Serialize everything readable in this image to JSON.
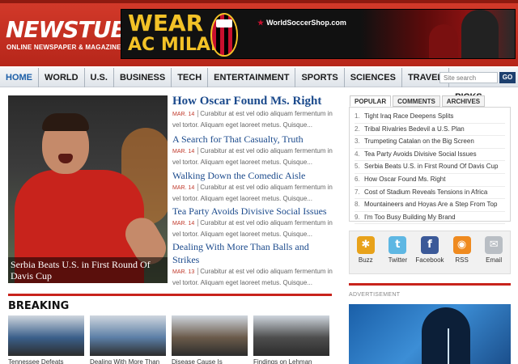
{
  "site": {
    "logo": "NEWSTUBE",
    "tagline": "ONLINE NEWSPAPER & MAGAZINE"
  },
  "banner": {
    "line1": "WEAR",
    "line2": "AC MILAN",
    "shop": "WorldSoccerShop.com"
  },
  "nav": {
    "items": [
      "HOME",
      "WORLD",
      "U.S.",
      "BUSINESS",
      "TECH",
      "ENTERTAINMENT",
      "SPORTS",
      "SCIENCES",
      "TRAVEL",
      "EDITOR'S PICKS"
    ],
    "search_placeholder": "Site search",
    "go_label": "GO"
  },
  "feature": {
    "caption": "Serbia Beats U.S. in First Round Of Davis Cup"
  },
  "articles": [
    {
      "title": "How Oscar Found Ms. Right",
      "date": "MAR. 14",
      "excerpt": "Curabitur at est vel odio aliquam fermentum in vel tortor. Aliquam eget laoreet metus. Quisque..."
    },
    {
      "title": "A Search for That Casualty, Truth",
      "date": "MAR. 14",
      "excerpt": "Curabitur at est vel odio aliquam fermentum in vel tortor. Aliquam eget laoreet metus. Quisque..."
    },
    {
      "title": "Walking Down the Comedic Aisle",
      "date": "MAR. 14",
      "excerpt": "Curabitur at est vel odio aliquam fermentum in vel tortor. Aliquam eget laoreet metus. Quisque..."
    },
    {
      "title": "Tea Party Avoids Divisive Social Issues",
      "date": "MAR. 14",
      "excerpt": "Curabitur at est vel odio aliquam fermentum in vel tortor. Aliquam eget laoreet metus. Quisque..."
    },
    {
      "title": "Dealing With More Than Balls and Strikes",
      "date": "MAR. 13",
      "excerpt": "Curabitur at est vel odio aliquam fermentum in vel tortor. Aliquam eget laoreet metus. Quisque..."
    }
  ],
  "breaking": {
    "title": "BREAKING",
    "items": [
      {
        "caption": "Tennessee Defeats",
        "color": "#3a5f8a"
      },
      {
        "caption": "Dealing With More Than",
        "color": "#5b7ea6"
      },
      {
        "caption": "Disease Cause Is",
        "color": "#6a5a4a"
      },
      {
        "caption": "Findings on Lehman",
        "color": "#4d4d4d"
      }
    ]
  },
  "sidebar": {
    "tabs": [
      "POPULAR",
      "COMMENTS",
      "ARCHIVES"
    ],
    "popular": [
      "Tight Iraq Race Deepens Splits",
      "Tribal Rivalries Bedevil a U.S. Plan",
      "Trumpeting Catalan on the Big Screen",
      "Tea Party Avoids Divisive Social Issues",
      "Serbia Beats U.S. in First Round Of Davis Cup",
      "How Oscar Found Ms. Right",
      "Cost of Stadium Reveals Tensions in Africa",
      "Mountaineers and Hoyas Are a Step From Top",
      "I'm Too Busy Building My Brand"
    ],
    "social": [
      {
        "label": "Buzz",
        "icon": "buzz-icon",
        "glyph": "✱",
        "color": "#e8a21a"
      },
      {
        "label": "Twitter",
        "icon": "twitter-icon",
        "glyph": "t",
        "color": "#5eb7e3"
      },
      {
        "label": "Facebook",
        "icon": "facebook-icon",
        "glyph": "f",
        "color": "#3b5998"
      },
      {
        "label": "RSS",
        "icon": "rss-icon",
        "glyph": "◉",
        "color": "#ef8a1f"
      },
      {
        "label": "Email",
        "icon": "email-icon",
        "glyph": "✉",
        "color": "#b9bec4"
      }
    ],
    "ad_label": "ADVERTISEMENT"
  },
  "colors": {
    "brand_red": "#c8231c",
    "link_blue": "#1b4a8c",
    "banner_gold": "#f3c227"
  }
}
